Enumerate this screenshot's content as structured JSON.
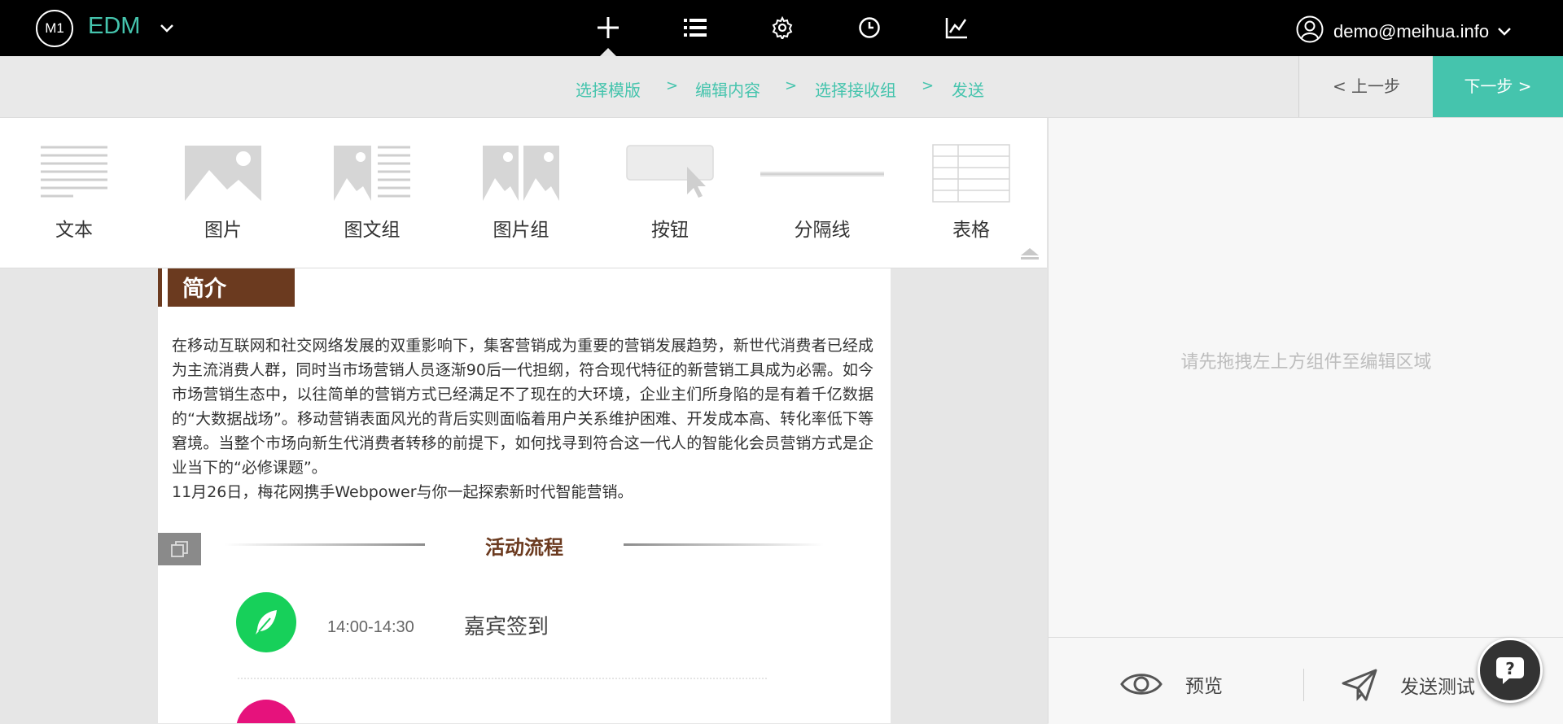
{
  "app": {
    "logo_text": "M1",
    "name": "EDM"
  },
  "user": {
    "email": "demo@meihua.info"
  },
  "steps": [
    {
      "label": "选择模版"
    },
    {
      "label": "编辑内容"
    },
    {
      "label": "选择接收组"
    },
    {
      "label": "发送"
    }
  ],
  "step_separator": ">",
  "buttons": {
    "prev": "< 上一步",
    "next": "下一步 >"
  },
  "palette": [
    {
      "label": "文本",
      "icon": "text-icon"
    },
    {
      "label": "图片",
      "icon": "image-icon"
    },
    {
      "label": "图文组",
      "icon": "image-text-icon"
    },
    {
      "label": "图片组",
      "icon": "image-group-icon"
    },
    {
      "label": "按钮",
      "icon": "button-icon"
    },
    {
      "label": "分隔线",
      "icon": "divider-icon"
    },
    {
      "label": "表格",
      "icon": "table-icon"
    }
  ],
  "right_panel": {
    "hint": "请先拖拽左上方组件至编辑区域",
    "preview": "预览",
    "send_test": "发送测试"
  },
  "content": {
    "intro_title": "简介",
    "paragraph": "在移动互联网和社交网络发展的双重影响下，集客营销成为重要的营销发展趋势，新世代消费者已经成为主流消费人群，同时当市场营销人员逐渐90后一代担纲，符合现代特征的新营销工具成为必需。如今市场营销生态中，以往简单的营销方式已经满足不了现在的大环境，企业主们所身陷的是有着千亿数据的“大数据战场”。移动营销表面风光的背后实则面临着用户关系维护困难、开发成本高、转化率低下等窘境。当整个市场向新生代消费者转移的前提下，如何找寻到符合这一代人的智能化会员营销方式是企业当下的“必修课题”。",
    "paragraph2": "11月26日，梅花网携手Webpower与你一起探索新时代智能营销。",
    "section_title": "活动流程",
    "flow": [
      {
        "time": "14:00-14:30",
        "name": "嘉宾签到",
        "color": "#17d05a"
      }
    ]
  },
  "colors": {
    "accent": "#45c4ad",
    "brown": "#6b3a1f"
  }
}
